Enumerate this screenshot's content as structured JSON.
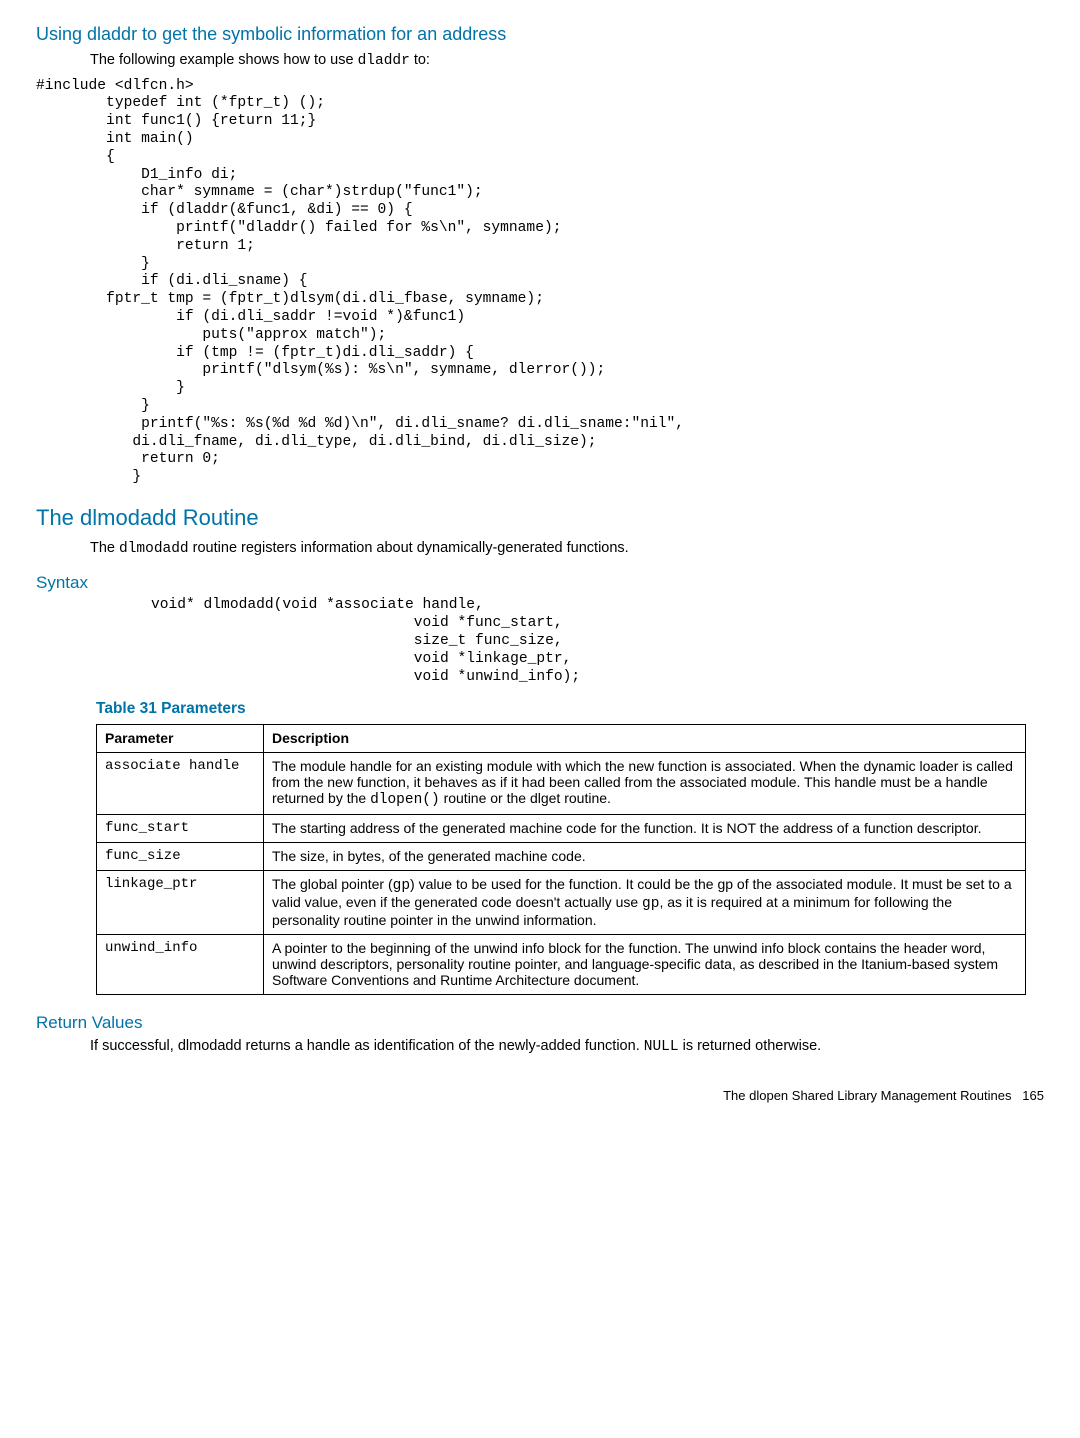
{
  "section1": {
    "title": "Using dladdr to get the symbolic information for an address",
    "intro_a": "The following example shows how to use ",
    "intro_code": "dladdr",
    "intro_b": " to:",
    "code": "#include <dlfcn.h>\n        typedef int (*fptr_t) ();\n        int func1() {return 11;}\n        int main()\n        {\n            D1_info di;\n            char* symname = (char*)strdup(\"func1\");\n            if (dladdr(&func1, &di) == 0) {\n                printf(\"dladdr() failed for %s\\n\", symname);\n                return 1;\n            }\n            if (di.dli_sname) {\n        fptr_t tmp = (fptr_t)dlsym(di.dli_fbase, symname);\n                if (di.dli_saddr !=void *)&func1)\n                   puts(\"approx match\");\n                if (tmp != (fptr_t)di.dli_saddr) {\n                   printf(\"dlsym(%s): %s\\n\", symname, dlerror());\n                }\n            }\n            printf(\"%s: %s(%d %d %d)\\n\", di.dli_sname? di.dli_sname:\"nil\",\n           di.dli_fname, di.dli_type, di.dli_bind, di.dli_size);\n            return 0;\n           }"
  },
  "section2": {
    "title": "The dlmodadd Routine",
    "body_a": "The ",
    "body_code": "dlmodadd",
    "body_b": " routine registers information about dynamically-generated functions."
  },
  "syntax": {
    "title": "Syntax",
    "code": "void* dlmodadd(void *associate handle,\n                              void *func_start,\n                              size_t func_size,\n                              void *linkage_ptr,\n                              void *unwind_info);"
  },
  "table": {
    "caption": "Table 31 Parameters",
    "header_param": "Parameter",
    "header_desc": "Description",
    "rows": [
      {
        "param": "associate handle",
        "desc_a": "The module handle for an existing module with which the new function is associated. When the dynamic loader is called from the new function, it behaves as if it had been called from the associated module. This handle must be a handle returned by the ",
        "code1": "dlopen()",
        "desc_b": " routine or the dlget routine."
      },
      {
        "param": "func_start",
        "desc_a": "The starting address of the generated machine code for the function. It is NOT the address of a function descriptor."
      },
      {
        "param": "func_size",
        "desc_a": "The size, in bytes, of the generated machine code."
      },
      {
        "param": "linkage_ptr",
        "desc_a": "The global pointer (",
        "code1": "gp",
        "desc_b": ") value to be used for the function. It could be the gp of the associated module. It must be set to a valid value, even if the generated code doesn't actually use  ",
        "code2": "gp",
        "desc_c": ", as it is required at a minimum for following the personality routine pointer in the unwind information."
      },
      {
        "param": "unwind_info",
        "desc_a": "A pointer to the beginning of the unwind info block for the function. The unwind info block contains the header word, unwind descriptors, personality routine pointer, and language-specific data, as described in the Itanium-based system Software Conventions and Runtime Architecture document."
      }
    ]
  },
  "return": {
    "title": "Return Values",
    "body_a": "If successful, dlmodadd returns a handle as identification of the newly-added function. ",
    "code": "NULL",
    "body_b": " is returned otherwise."
  },
  "footer": {
    "text": "The dlopen Shared Library Management Routines",
    "page": "165"
  }
}
